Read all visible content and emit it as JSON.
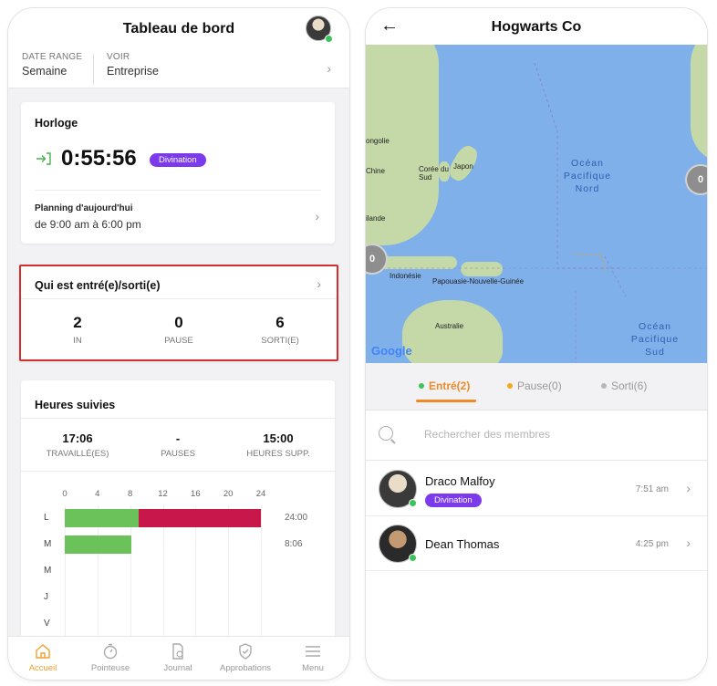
{
  "left": {
    "header": {
      "title": "Tableau de bord"
    },
    "filters": {
      "date_range_label": "DATE RANGE",
      "date_range_value": "Semaine",
      "voir_label": "VOIR",
      "voir_value": "Entreprise"
    },
    "clock": {
      "title": "Horloge",
      "time": "0:55:56",
      "badge": "Divination",
      "planning_label": "Planning d'aujourd'hui",
      "planning_value": "de 9:00 am à 6:00 pm"
    },
    "who": {
      "title": "Qui est entré(e)/sorti(e)",
      "stats": [
        {
          "value": "2",
          "label": "IN"
        },
        {
          "value": "0",
          "label": "PAUSE"
        },
        {
          "value": "6",
          "label": "SORTI(E)"
        }
      ]
    },
    "hours": {
      "title": "Heures suivies",
      "stats": [
        {
          "value": "17:06",
          "label": "TRAVAILLÉ(ES)"
        },
        {
          "value": "-",
          "label": "PAUSES"
        },
        {
          "value": "15:00",
          "label": "HEURES SUPP."
        }
      ]
    },
    "chart_data": {
      "type": "bar",
      "orientation": "horizontal",
      "stacked": true,
      "categories": [
        "L",
        "M",
        "M",
        "J",
        "V"
      ],
      "x_ticks": [
        "0",
        "4",
        "8",
        "12",
        "16",
        "20",
        "24"
      ],
      "xlim": [
        0,
        24
      ],
      "series": [
        {
          "values": [
            9,
            8.1,
            0,
            0,
            0
          ],
          "color": "#6bc15a"
        },
        {
          "values": [
            15,
            0,
            0,
            0,
            0
          ],
          "color": "#c8174a"
        }
      ],
      "value_labels": [
        "24:00",
        "8:06",
        "",
        "",
        ""
      ]
    },
    "tabbar": [
      {
        "label": "Accueil",
        "icon": "home-icon",
        "active": true
      },
      {
        "label": "Pointeuse",
        "icon": "stopwatch-icon",
        "active": false
      },
      {
        "label": "Journal",
        "icon": "journal-icon",
        "active": false
      },
      {
        "label": "Approbations",
        "icon": "shield-check-icon",
        "active": false
      },
      {
        "label": "Menu",
        "icon": "menu-icon",
        "active": false
      }
    ],
    "colors": {
      "accent": "#f0a030",
      "badge": "#7c3aed",
      "highlight_border": "#d32f2f"
    }
  },
  "right": {
    "header": {
      "title": "Hogwarts Co"
    },
    "map": {
      "labels": [
        "ongolie",
        "Chine",
        "Corée du Sud",
        "Japon",
        "ilande",
        "Indonésie",
        "Papouasie-Nouvelle-Guinée",
        "Australie"
      ],
      "oceans": [
        "Océan Pacifique Nord",
        "Océan Pacifique Sud"
      ],
      "clusters": [
        "0",
        "0"
      ],
      "logo": "Google"
    },
    "segments": [
      {
        "label": "Entré(2)",
        "dot": "#3bc35c",
        "active": true
      },
      {
        "label": "Pause(0)",
        "dot": "#f5a623",
        "active": false
      },
      {
        "label": "Sorti(6)",
        "dot": "#b8b8b8",
        "active": false
      }
    ],
    "search": {
      "placeholder": "Rechercher des membres"
    },
    "members": [
      {
        "name": "Draco Malfoy",
        "badge": "Divination",
        "time": "7:51 am"
      },
      {
        "name": "Dean Thomas",
        "badge": "",
        "time": "4:25 pm"
      }
    ]
  }
}
